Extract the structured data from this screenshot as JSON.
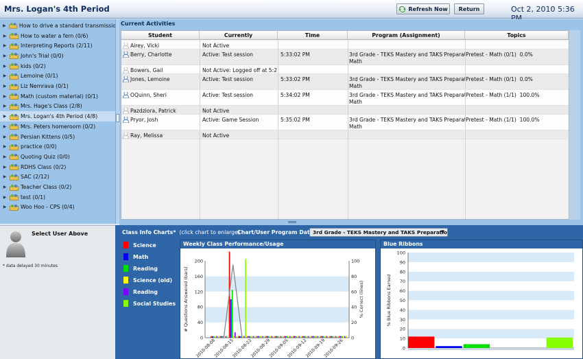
{
  "header": {
    "title": "Mrs. Logan's 4th Period",
    "refresh_label": "Refresh Now",
    "return_label": "Return",
    "datetime": "Oct 2, 2010 5:36 PM"
  },
  "sidebar": {
    "items": [
      {
        "label": "How to drive a standard transmission"
      },
      {
        "label": "How to water a fern (0/6)"
      },
      {
        "label": "Interpreting Reports (2/11)"
      },
      {
        "label": "John's Trial (0/0)"
      },
      {
        "label": "kids (0/2)"
      },
      {
        "label": "Lemoine (0/1)"
      },
      {
        "label": "Liz Nemrava (0/1)"
      },
      {
        "label": "Math (custom material) (0/1)"
      },
      {
        "label": "Mrs. Hage's Class (2/8)"
      },
      {
        "label": "Mrs. Logan's 4th Period (4/8)",
        "selected": true
      },
      {
        "label": "Mrs. Peters homeroom (0/2)"
      },
      {
        "label": "Persian Kittens (0/5)"
      },
      {
        "label": "practice (0/0)"
      },
      {
        "label": "Quoting Quiz (0/0)"
      },
      {
        "label": "RDHS Class (0/2)"
      },
      {
        "label": "SAC (2/12)"
      },
      {
        "label": "Teacher Class (0/2)"
      },
      {
        "label": "test (0/1)"
      },
      {
        "label": "Woo Hoo - CPS (0/4)"
      }
    ]
  },
  "user_panel": {
    "select_label": "Select User Above",
    "note": "* data delayed 30 minutes"
  },
  "activities": {
    "title": "Current Activities",
    "columns": [
      "Student",
      "Currently",
      "Time",
      "Program (Assignment)",
      "Topics"
    ],
    "rows": [
      {
        "student": "Airey, Vicki",
        "status": "Not Active",
        "time": "",
        "program": "",
        "topics": "",
        "active": false
      },
      {
        "student": "Berry, Charlotte",
        "status": "Active: Test session",
        "time": "5:33:02 PM",
        "program": "3rd Grade - TEKS Mastery and TAKS Preparat\nMath",
        "topics": "Pretest - Math (0/1)  0.0%",
        "active": true
      },
      {
        "student": "Bowers, Gail",
        "status": "Not Active: Logged off at 5:2",
        "time": "",
        "program": "",
        "topics": "",
        "active": false
      },
      {
        "student": "Jones, Lemoine",
        "status": "Active: Test session",
        "time": "5:33:02 PM",
        "program": "3rd Grade - TEKS Mastery and TAKS Preparat\nMath",
        "topics": "Pretest - Math (0/1)  0.0%",
        "active": true
      },
      {
        "student": "OQuinn, Sheri",
        "status": "Active: Test session",
        "time": "5:34:02 PM",
        "program": "3rd Grade - TEKS Mastery and TAKS Preparat\nMath",
        "topics": "Pretest - Math (1/1)  100.0%",
        "active": true
      },
      {
        "student": "Pazdziora, Patrick",
        "status": "Not Active",
        "time": "",
        "program": "",
        "topics": "",
        "active": false
      },
      {
        "student": "Pryor, Josh",
        "status": "Active: Game Session",
        "time": "5:35:02 PM",
        "program": "3rd Grade - TEKS Mastery and TAKS Preparat\nMath",
        "topics": "Pretest - Math (1/1)  100.0%",
        "active": true
      },
      {
        "student": "Ray, Melissa",
        "status": "Not Active",
        "time": "",
        "program": "",
        "topics": "",
        "active": false
      }
    ]
  },
  "charts_panel": {
    "label_bold": "Class Info Charts*",
    "label_rest": "(click chart to enlarge)",
    "program_label": "Chart/User Program Data:",
    "program_value": "3rd Grade - TEKS Mastery and TAKS Preparatio",
    "legend": [
      {
        "name": "Science",
        "color": "#ff0000"
      },
      {
        "name": "Math",
        "color": "#0000ee"
      },
      {
        "name": "Reading",
        "color": "#00dd00"
      },
      {
        "name": "Science (old)",
        "color": "#ffff00"
      },
      {
        "name": "Reading",
        "color": "#7a00ff"
      },
      {
        "name": "Social Studies",
        "color": "#88ff00"
      }
    ]
  },
  "chart_data": [
    {
      "type": "bar",
      "title": "Weekly Class Performance/Usage",
      "ylabel": "# Questions Answered (bars)",
      "y2label": "% Correct (lines)",
      "ylim": [
        0,
        200
      ],
      "y2lim": [
        0,
        100
      ],
      "yticks": [
        0,
        40,
        80,
        120,
        160,
        200
      ],
      "y2ticks": [
        0,
        20,
        40,
        60,
        80,
        100
      ],
      "categories": [
        "2010-08-08",
        "2010-08-11",
        "2010-08-15",
        "2010-08-18",
        "2010-08-22",
        "2010-08-25",
        "2010-08-29",
        "2010-09-01",
        "2010-09-05",
        "2010-09-08",
        "2010-09-12",
        "2010-09-15",
        "2010-09-19",
        "2010-09-22",
        "2010-09-26"
      ],
      "xtick_labels": [
        "2010-08-08",
        "2010-08-15",
        "2010-08-22",
        "2010-08-29",
        "2010-09-05",
        "2010-09-12",
        "2010-09-19",
        "2010-09-26"
      ],
      "series": [
        {
          "name": "Science",
          "color": "#ff0000",
          "values": [
            4,
            4,
            230,
            4,
            4,
            4,
            4,
            4,
            4,
            4,
            4,
            4,
            4,
            4,
            4
          ]
        },
        {
          "name": "Math",
          "color": "#0000ee",
          "values": [
            4,
            4,
            100,
            4,
            4,
            4,
            4,
            4,
            4,
            4,
            4,
            4,
            4,
            4,
            4
          ]
        },
        {
          "name": "Reading",
          "color": "#00dd00",
          "values": [
            4,
            4,
            125,
            4,
            4,
            4,
            4,
            4,
            4,
            4,
            4,
            4,
            4,
            4,
            4
          ]
        },
        {
          "name": "Science (old)",
          "color": "#ffff00",
          "values": [
            4,
            4,
            4,
            4,
            4,
            4,
            4,
            4,
            4,
            4,
            4,
            4,
            4,
            4,
            4
          ]
        },
        {
          "name": "Reading",
          "color": "#7a00ff",
          "values": [
            4,
            4,
            14,
            4,
            4,
            4,
            4,
            4,
            4,
            4,
            4,
            4,
            4,
            4,
            4
          ]
        },
        {
          "name": "Social Studies",
          "color": "#88ff00",
          "values": [
            4,
            4,
            4,
            205,
            4,
            4,
            4,
            4,
            4,
            4,
            4,
            4,
            4,
            4,
            4
          ]
        }
      ],
      "line_series": [
        {
          "values": [
            0,
            0,
            95,
            0,
            0,
            0,
            0,
            0,
            0,
            0,
            0,
            0,
            0,
            0,
            0
          ],
          "color": "#888888"
        }
      ]
    },
    {
      "type": "bar",
      "title": "Blue Ribbons",
      "ylabel": "% Blue Ribbons Earned",
      "ylim": [
        0,
        100
      ],
      "yticks": [
        0,
        10,
        20,
        30,
        40,
        50,
        60,
        70,
        80,
        90,
        100
      ],
      "series": [
        {
          "name": "Science",
          "color": "#ff0000",
          "value": 12
        },
        {
          "name": "Math",
          "color": "#0000ee",
          "value": 2
        },
        {
          "name": "Reading",
          "color": "#00dd00",
          "value": 4
        },
        {
          "name": "Science (old)",
          "color": "#ffff00",
          "value": 0
        },
        {
          "name": "Reading",
          "color": "#7a00ff",
          "value": 0
        },
        {
          "name": "Social Studies",
          "color": "#88ff00",
          "value": 11
        }
      ]
    }
  ]
}
